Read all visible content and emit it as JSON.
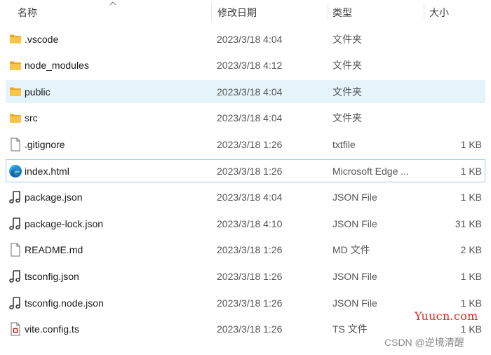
{
  "header": {
    "name": "名称",
    "date": "修改日期",
    "type": "类型",
    "size": "大小"
  },
  "files": [
    {
      "name": ".vscode",
      "date": "2023/3/18 4:04",
      "type": "文件夹",
      "size": "",
      "icon": "folder-icon"
    },
    {
      "name": "node_modules",
      "date": "2023/3/18 4:12",
      "type": "文件夹",
      "size": "",
      "icon": "folder-icon"
    },
    {
      "name": "public",
      "date": "2023/3/18 4:04",
      "type": "文件夹",
      "size": "",
      "icon": "folder-icon",
      "state": "hovered"
    },
    {
      "name": "src",
      "date": "2023/3/18 4:04",
      "type": "文件夹",
      "size": "",
      "icon": "folder-icon"
    },
    {
      "name": ".gitignore",
      "date": "2023/3/18 1:26",
      "type": "txtfile",
      "size": "1 KB",
      "icon": "text-file-icon"
    },
    {
      "name": "index.html",
      "date": "2023/3/18 1:26",
      "type": "Microsoft Edge ...",
      "size": "1 KB",
      "icon": "edge-icon",
      "state": "focused"
    },
    {
      "name": "package.json",
      "date": "2023/3/18 4:04",
      "type": "JSON File",
      "size": "1 KB",
      "icon": "json-file-icon"
    },
    {
      "name": "package-lock.json",
      "date": "2023/3/18 4:10",
      "type": "JSON File",
      "size": "31 KB",
      "icon": "json-file-icon"
    },
    {
      "name": "README.md",
      "date": "2023/3/18 1:26",
      "type": "MD 文件",
      "size": "2 KB",
      "icon": "text-file-icon"
    },
    {
      "name": "tsconfig.json",
      "date": "2023/3/18 1:26",
      "type": "JSON File",
      "size": "1 KB",
      "icon": "json-file-icon"
    },
    {
      "name": "tsconfig.node.json",
      "date": "2023/3/18 1:26",
      "type": "JSON File",
      "size": "1 KB",
      "icon": "json-file-icon"
    },
    {
      "name": "vite.config.ts",
      "date": "2023/3/18 1:26",
      "type": "TS 文件",
      "size": "1 KB",
      "icon": "ts-file-icon"
    }
  ],
  "watermarks": {
    "site": "Yuucn.com",
    "author": "CSDN @逆境清醒"
  },
  "colors": {
    "folder": "#f8c54b",
    "hover": "#e5f3fb",
    "focus_border": "#99d1ef",
    "watermark_red": "#e0281e"
  }
}
